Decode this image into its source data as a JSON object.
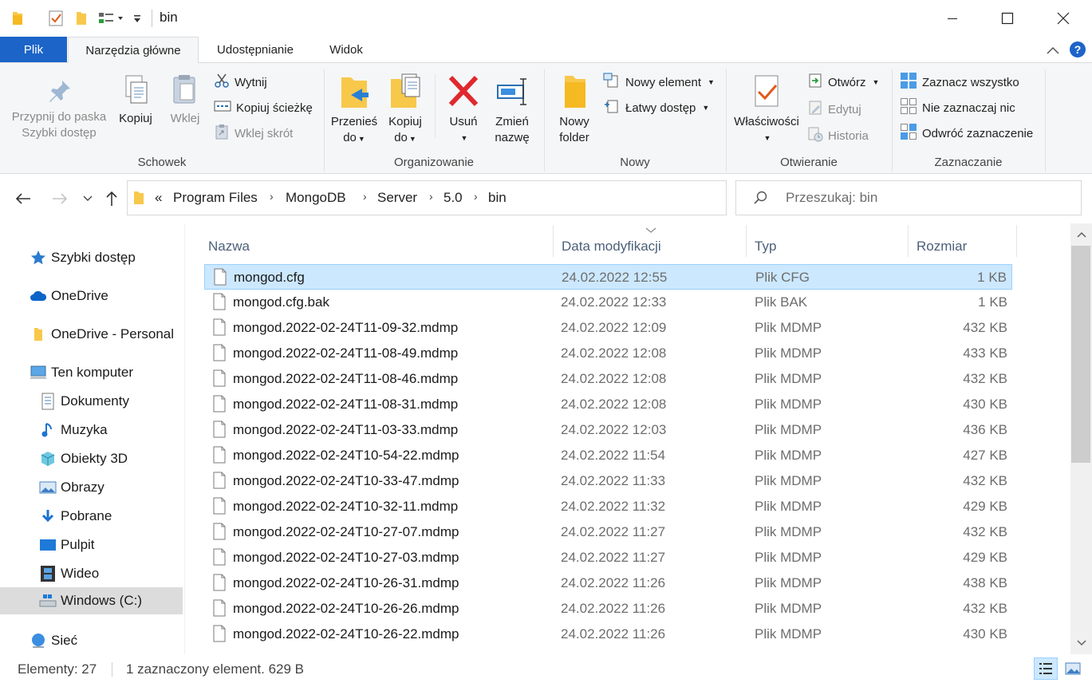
{
  "window": {
    "title": "bin"
  },
  "tabs": {
    "file": "Plik",
    "home": "Narzędzia główne",
    "share": "Udostępnianie",
    "view": "Widok"
  },
  "ribbon": {
    "clipboard": {
      "label": "Schowek",
      "pin_line1": "Przypnij do paska",
      "pin_line2": "Szybki dostęp",
      "copy": "Kopiuj",
      "paste": "Wklej",
      "cut": "Wytnij",
      "copy_path": "Kopiuj ścieżkę",
      "paste_shortcut": "Wklej skrót"
    },
    "organize": {
      "label": "Organizowanie",
      "move_line1": "Przenieś",
      "move_line2": "do",
      "copyto_line1": "Kopiuj",
      "copyto_line2": "do",
      "delete": "Usuń",
      "rename_line1": "Zmień",
      "rename_line2": "nazwę"
    },
    "new": {
      "label": "Nowy",
      "folder_line1": "Nowy",
      "folder_line2": "folder",
      "new_item": "Nowy element",
      "easy_access": "Łatwy dostęp"
    },
    "open": {
      "label": "Otwieranie",
      "properties": "Właściwości",
      "open": "Otwórz",
      "edit": "Edytuj",
      "history": "Historia"
    },
    "select": {
      "label": "Zaznaczanie",
      "select_all": "Zaznacz wszystko",
      "select_none": "Nie zaznaczaj nic",
      "invert": "Odwróć zaznaczenie"
    }
  },
  "address": {
    "overflow": "«",
    "crumbs": [
      "Program Files",
      "MongoDB",
      "Server",
      "5.0",
      "bin"
    ],
    "search_placeholder": "Przeszukaj: bin"
  },
  "nav": {
    "quick_access": "Szybki dostęp",
    "onedrive": "OneDrive",
    "onedrive_personal": "OneDrive - Personal",
    "this_pc": "Ten komputer",
    "documents": "Dokumenty",
    "music": "Muzyka",
    "objects3d": "Obiekty 3D",
    "pictures": "Obrazy",
    "downloads": "Pobrane",
    "desktop": "Pulpit",
    "videos": "Wideo",
    "windows_c": "Windows (C:)",
    "network": "Sieć"
  },
  "columns": {
    "name": "Nazwa",
    "date": "Data modyfikacji",
    "type": "Typ",
    "size": "Rozmiar"
  },
  "files": [
    {
      "name": "mongod.cfg",
      "date": "24.02.2022 12:55",
      "type": "Plik CFG",
      "size": "1 KB",
      "selected": true
    },
    {
      "name": "mongod.cfg.bak",
      "date": "24.02.2022 12:33",
      "type": "Plik BAK",
      "size": "1 KB"
    },
    {
      "name": "mongod.2022-02-24T11-09-32.mdmp",
      "date": "24.02.2022 12:09",
      "type": "Plik MDMP",
      "size": "432 KB"
    },
    {
      "name": "mongod.2022-02-24T11-08-49.mdmp",
      "date": "24.02.2022 12:08",
      "type": "Plik MDMP",
      "size": "433 KB"
    },
    {
      "name": "mongod.2022-02-24T11-08-46.mdmp",
      "date": "24.02.2022 12:08",
      "type": "Plik MDMP",
      "size": "432 KB"
    },
    {
      "name": "mongod.2022-02-24T11-08-31.mdmp",
      "date": "24.02.2022 12:08",
      "type": "Plik MDMP",
      "size": "430 KB"
    },
    {
      "name": "mongod.2022-02-24T11-03-33.mdmp",
      "date": "24.02.2022 12:03",
      "type": "Plik MDMP",
      "size": "436 KB"
    },
    {
      "name": "mongod.2022-02-24T10-54-22.mdmp",
      "date": "24.02.2022 11:54",
      "type": "Plik MDMP",
      "size": "427 KB"
    },
    {
      "name": "mongod.2022-02-24T10-33-47.mdmp",
      "date": "24.02.2022 11:33",
      "type": "Plik MDMP",
      "size": "432 KB"
    },
    {
      "name": "mongod.2022-02-24T10-32-11.mdmp",
      "date": "24.02.2022 11:32",
      "type": "Plik MDMP",
      "size": "429 KB"
    },
    {
      "name": "mongod.2022-02-24T10-27-07.mdmp",
      "date": "24.02.2022 11:27",
      "type": "Plik MDMP",
      "size": "432 KB"
    },
    {
      "name": "mongod.2022-02-24T10-27-03.mdmp",
      "date": "24.02.2022 11:27",
      "type": "Plik MDMP",
      "size": "429 KB"
    },
    {
      "name": "mongod.2022-02-24T10-26-31.mdmp",
      "date": "24.02.2022 11:26",
      "type": "Plik MDMP",
      "size": "438 KB"
    },
    {
      "name": "mongod.2022-02-24T10-26-26.mdmp",
      "date": "24.02.2022 11:26",
      "type": "Plik MDMP",
      "size": "432 KB"
    },
    {
      "name": "mongod.2022-02-24T10-26-22.mdmp",
      "date": "24.02.2022 11:26",
      "type": "Plik MDMP",
      "size": "430 KB"
    }
  ],
  "status": {
    "count": "Elementy: 27",
    "selection": "1 zaznaczony element. 629 B"
  },
  "colors": {
    "accent": "#1c64c8",
    "selection": "#cce8ff",
    "selection_border": "#99d1ff",
    "folder": "#f8c84b",
    "delete_red": "#e0282e"
  }
}
